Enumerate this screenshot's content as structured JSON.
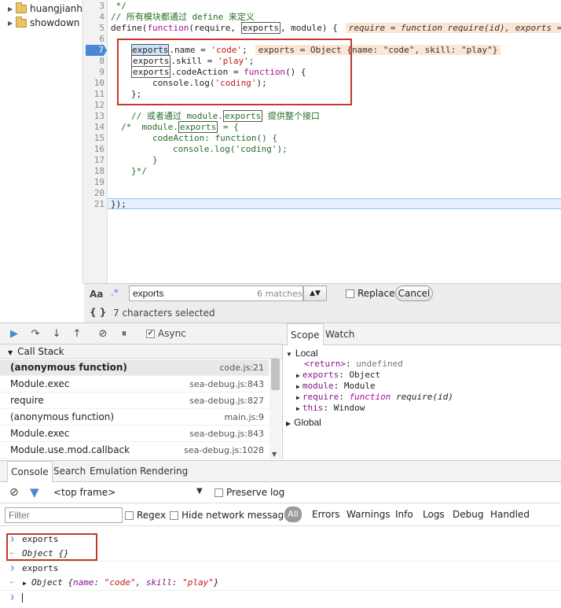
{
  "file_tree": {
    "items": [
      "huangjianhua",
      "showdown"
    ]
  },
  "editor": {
    "lines": [
      "3",
      "4",
      "5",
      "6",
      "7",
      "8",
      "9",
      "10",
      "11",
      "12",
      "13",
      "14",
      "15",
      "16",
      "17",
      "18",
      "19",
      "20",
      "21"
    ],
    "code": {
      "l3": " */",
      "l4": "// 所有模块都通过 define 来定义",
      "l5_a": "define(",
      "l5_kw": "function",
      "l5_b": "(require, ",
      "l5_box": "exports",
      "l5_c": ", module) {",
      "l5_inline": "require = function require(id), exports =",
      "l7_word": "exports",
      "l7_rest": ".name = ",
      "l7_str": "'code'",
      "l7_end": ";",
      "l7_inline_a": "exports = Object {",
      "l7_inline_b": "name: \"code\", skill: \"play\"}",
      "l8_word": "exports",
      "l8_rest": ".skill = ",
      "l8_str": "'play'",
      "l8_end": ";",
      "l9_word": "exports",
      "l9_rest": ".codeAction = ",
      "l9_kw": "function",
      "l9_end": "() {",
      "l10_a": "console.log(",
      "l10_str": "'coding'",
      "l10_b": ");",
      "l11": "};",
      "l13_a": "// 或者通过 module.",
      "l13_box": "exports",
      "l13_b": " 提供整个接口",
      "l14_a": "/*  module.",
      "l14_box": "exports",
      "l14_b": " = {",
      "l15": "codeAction: function() {",
      "l16": "console.log('coding');",
      "l17": "}",
      "l18": "}*/",
      "l21": "});"
    }
  },
  "find": {
    "aa_label": "Aa",
    "regex_label": ".*",
    "query": "exports",
    "matches": "6 matches",
    "replace_label": "Replace",
    "cancel_label": "Cancel",
    "braces_label": "{ }",
    "status": "7 characters selected"
  },
  "debugger": {
    "async_label": "Async"
  },
  "call_stack": {
    "title": "Call Stack",
    "frames": [
      {
        "name": "(anonymous function)",
        "loc": "code.js:21"
      },
      {
        "name": "Module.exec",
        "loc": "sea-debug.js:843"
      },
      {
        "name": "require",
        "loc": "sea-debug.js:827"
      },
      {
        "name": "(anonymous function)",
        "loc": "main.js:9"
      },
      {
        "name": "Module.exec",
        "loc": "sea-debug.js:843"
      },
      {
        "name": "Module.use.mod.callback",
        "loc": "sea-debug.js:1028"
      }
    ]
  },
  "scope": {
    "tabs": [
      "Scope",
      "Watch"
    ],
    "local_label": "Local",
    "return_key": "<return>",
    "return_val": "undefined",
    "exports_key": "exports",
    "exports_val": "Object",
    "module_key": "module",
    "module_val": "Module",
    "require_key": "require",
    "require_kw": "function",
    "require_val": "require(id)",
    "this_key": "this",
    "this_val": "Window",
    "global_label": "Global"
  },
  "console": {
    "tabs": [
      "Console",
      "Search",
      "Emulation",
      "Rendering"
    ],
    "frame": "<top frame>",
    "preserve_log": "Preserve log",
    "filter_placeholder": "Filter",
    "regex": "Regex",
    "hide_network": "Hide network messages",
    "levels": [
      "All",
      "Errors",
      "Warnings",
      "Info",
      "Logs",
      "Debug",
      "Handled"
    ],
    "entries": {
      "in1": "exports",
      "out1": "Object {}",
      "in2": "exports",
      "out2_a": "Object {",
      "out2_k1": "name",
      "out2_v1": "\"code\"",
      "out2_k2": "skill",
      "out2_v2": "\"play\"",
      "out2_b": "}"
    }
  },
  "colors": {
    "accent": "#4a87d6",
    "highlight_box": "#c0392b"
  }
}
